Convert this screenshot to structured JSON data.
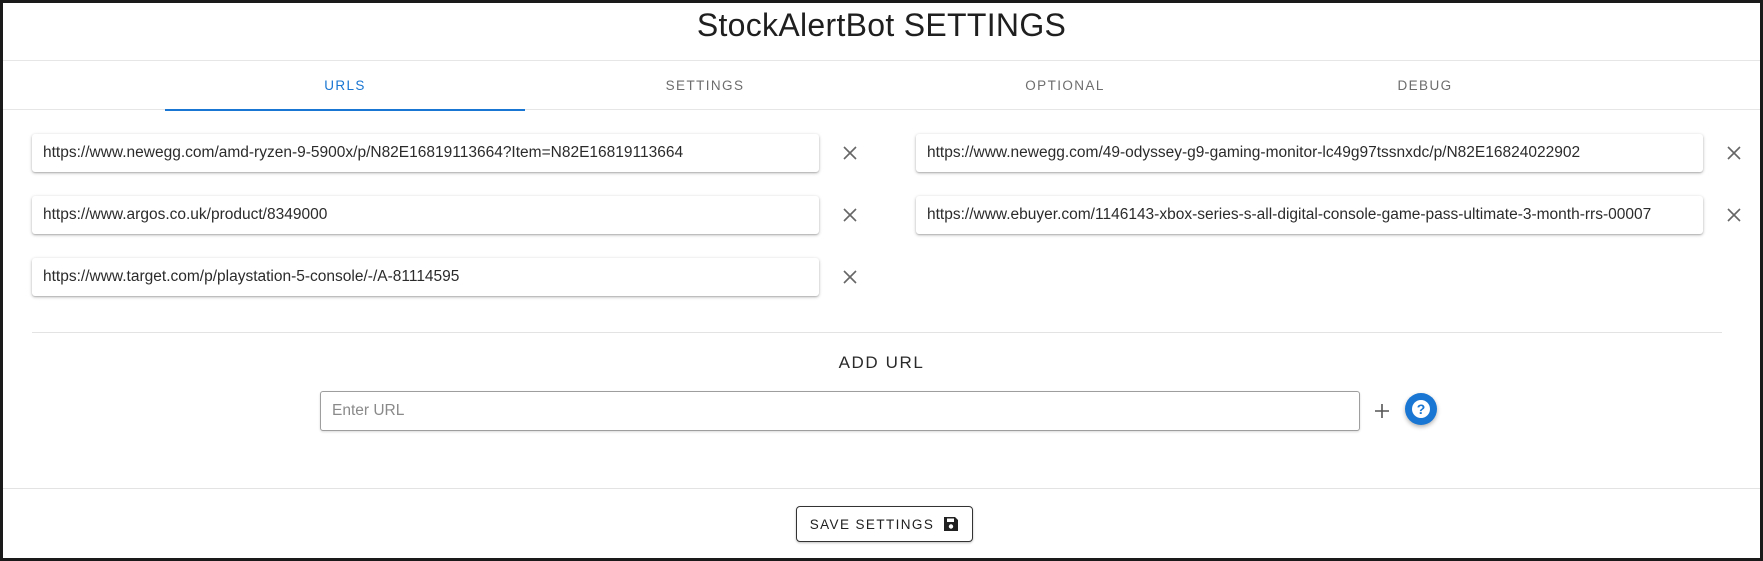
{
  "app": {
    "title": "StockAlertBot SETTINGS"
  },
  "tabs": [
    {
      "label": "URLS",
      "active": true
    },
    {
      "label": "SETTINGS",
      "active": false
    },
    {
      "label": "OPTIONAL",
      "active": false
    },
    {
      "label": "DEBUG",
      "active": false
    }
  ],
  "urls": [
    "https://www.newegg.com/amd-ryzen-9-5900x/p/N82E16819113664?Item=N82E16819113664",
    "https://www.newegg.com/49-odyssey-g9-gaming-monitor-lc49g97tssnxdc/p/N82E16824022902",
    "https://www.argos.co.uk/product/8349000",
    "https://www.ebuyer.com/1146143-xbox-series-s-all-digital-console-game-pass-ultimate-3-month-rrs-00007",
    "https://www.target.com/p/playstation-5-console/-/A-81114595"
  ],
  "url_item_icon": "close-icon",
  "add_url": {
    "heading": "ADD URL",
    "placeholder": "Enter URL",
    "value": "",
    "add_icon": "plus-icon",
    "help_icon": "help-icon",
    "help_glyph": "?"
  },
  "footer": {
    "save_label": "SAVE SETTINGS",
    "save_icon": "floppy-disk-icon"
  },
  "colors": {
    "accent": "#1976d2",
    "tab_inactive": "#6d6d6d"
  }
}
